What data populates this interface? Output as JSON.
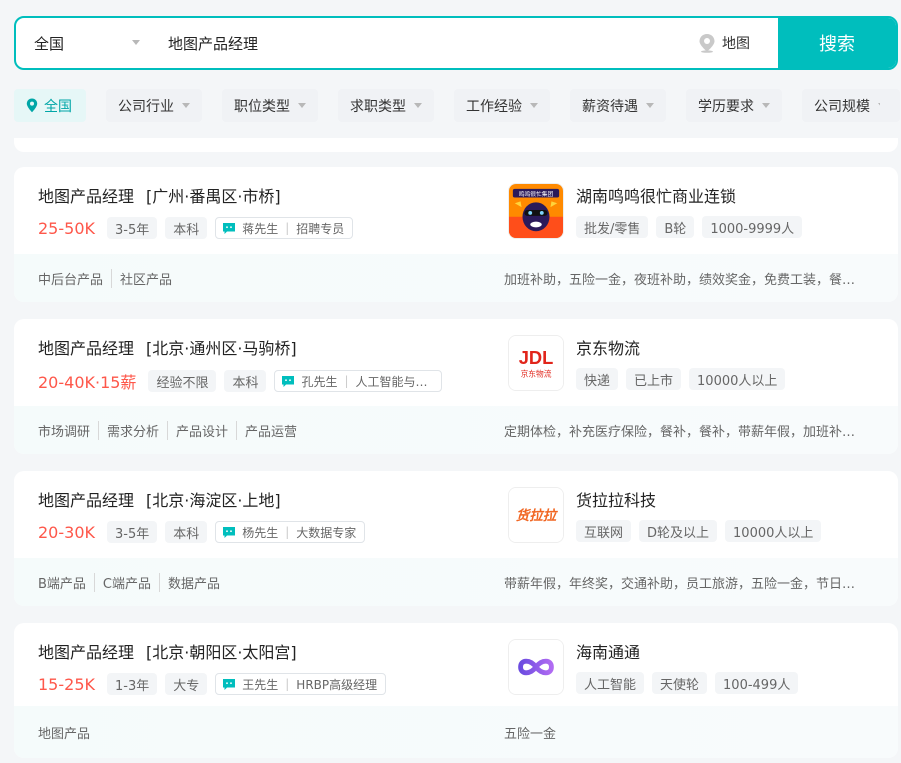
{
  "search": {
    "city": "全国",
    "query": "地图产品经理",
    "map_label": "地图",
    "button_label": "搜索"
  },
  "filters": [
    {
      "label": "全国",
      "active": true
    },
    {
      "label": "公司行业"
    },
    {
      "label": "职位类型"
    },
    {
      "label": "求职类型"
    },
    {
      "label": "工作经验"
    },
    {
      "label": "薪资待遇"
    },
    {
      "label": "学历要求"
    },
    {
      "label": "公司规模"
    }
  ],
  "jobs": [
    {
      "title": "地图产品经理",
      "location": "[广州·番禺区·市桥]",
      "salary": "25-50K",
      "tags": [
        "3-5年",
        "本科"
      ],
      "recruiter_name": "蒋先生",
      "recruiter_role": "招聘专员",
      "skills": [
        "中后台产品",
        "社区产品"
      ],
      "benefits": "加班补助，五险一金，夜班补助，绩效奖金，免费工装，餐补，带薪年假",
      "company": {
        "name": "湖南鸣鸣很忙商业连锁",
        "tags": [
          "批发/零售",
          "B轮",
          "1000-9999人"
        ],
        "logo_text": "鸣鸣很忙集团",
        "logo_icon": "mascot-logo"
      }
    },
    {
      "title": "地图产品经理",
      "location": "[北京·通州区·马驹桥]",
      "salary": "20-40K·15薪",
      "tags": [
        "经验不限",
        "本科"
      ],
      "recruiter_name": "孔先生",
      "recruiter_role": "人工智能与大数据",
      "skills": [
        "市场调研",
        "需求分析",
        "产品设计",
        "产品运营"
      ],
      "benefits": "定期体检，补充医疗保险，餐补，餐补，带薪年假，加班补助，五险一金",
      "company": {
        "name": "京东物流",
        "tags": [
          "快递",
          "已上市",
          "10000人以上"
        ],
        "logo_text": "JDL",
        "logo_subtext": "京东物流",
        "logo_icon": "jdl-logo"
      }
    },
    {
      "title": "地图产品经理",
      "location": "[北京·海淀区·上地]",
      "salary": "20-30K",
      "tags": [
        "3-5年",
        "本科"
      ],
      "recruiter_name": "杨先生",
      "recruiter_role": "大数据专家",
      "skills": [
        "B端产品",
        "C端产品",
        "数据产品"
      ],
      "benefits": "带薪年假，年终奖，交通补助，员工旅游，五险一金，节日福利",
      "company": {
        "name": "货拉拉科技",
        "tags": [
          "互联网",
          "D轮及以上",
          "10000人以上"
        ],
        "logo_text": "货拉拉",
        "logo_icon": "lalamove-logo"
      }
    },
    {
      "title": "地图产品经理",
      "location": "[北京·朝阳区·太阳宫]",
      "salary": "15-25K",
      "tags": [
        "1-3年",
        "大专"
      ],
      "recruiter_name": "王先生",
      "recruiter_role": "HRBP高级经理",
      "skills": [
        "地图产品"
      ],
      "benefits": "五险一金",
      "company": {
        "name": "海南通通",
        "tags": [
          "人工智能",
          "天使轮",
          "100-499人"
        ],
        "logo_icon": "infinity-logo"
      }
    }
  ],
  "colors": {
    "accent": "#00bebd",
    "salary": "#fe574a"
  }
}
